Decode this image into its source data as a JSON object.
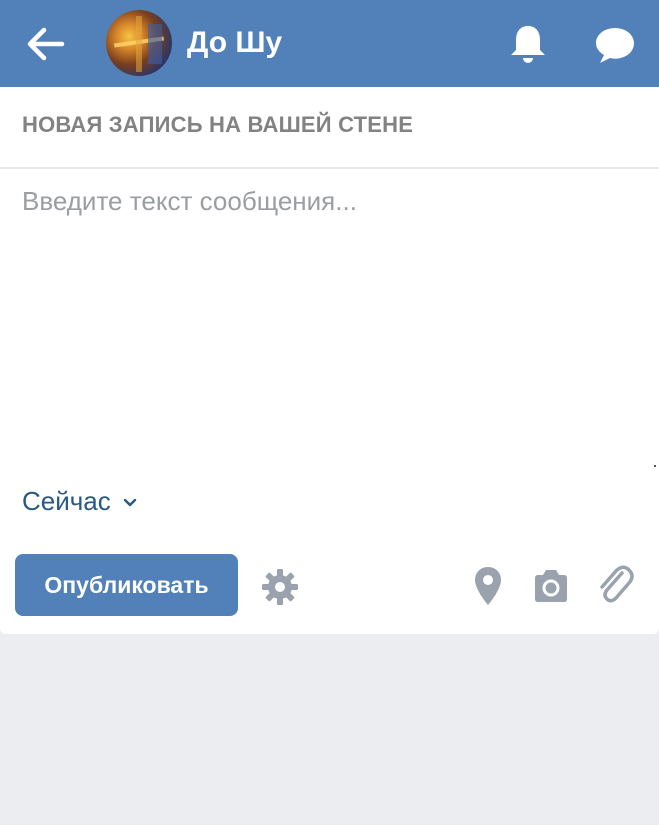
{
  "header": {
    "title": "До Шу",
    "background_color": "#5181b8",
    "back_icon": "arrow-left-icon",
    "notifications_icon": "bell-icon",
    "messages_icon": "speech-bubble-icon"
  },
  "composer": {
    "title": "НОВАЯ ЗАПИСЬ НА ВАШЕЙ СТЕНЕ",
    "message": {
      "value": "",
      "placeholder": "Введите текст сообщения..."
    },
    "time": {
      "selected": "Сейчас"
    },
    "publish_label": "Опубликовать",
    "settings_icon": "gear-icon",
    "attachments": [
      "location-pin-icon",
      "camera-icon",
      "paperclip-icon"
    ]
  },
  "colors": {
    "accent": "#5181b8",
    "link": "#2a5885",
    "icon_gray": "#99a2ad",
    "page_background": "#ebedf0"
  }
}
